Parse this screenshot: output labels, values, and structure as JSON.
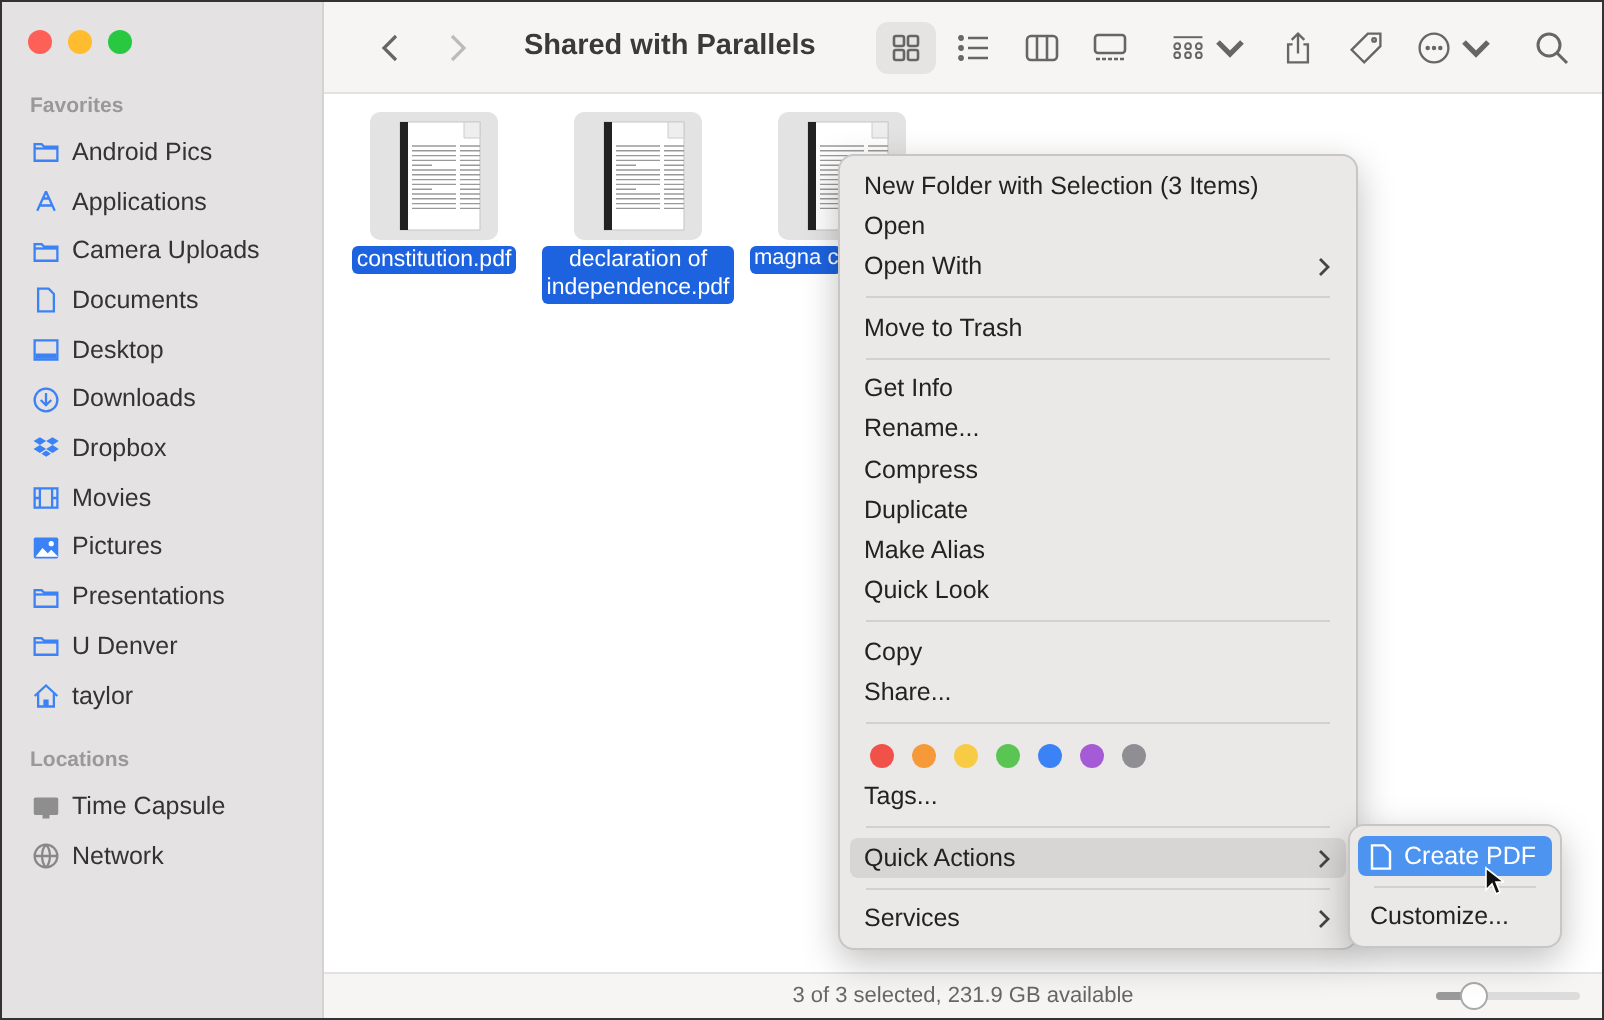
{
  "window": {
    "title": "Shared with Parallels"
  },
  "toolbar": {
    "view_modes": [
      {
        "kind": "icons",
        "selected": true
      },
      {
        "kind": "list",
        "selected": false
      },
      {
        "kind": "columns",
        "selected": false
      },
      {
        "kind": "gallery",
        "selected": false
      }
    ]
  },
  "sidebar": {
    "sections": [
      {
        "title": "Favorites",
        "items": [
          {
            "label": "Android Pics",
            "kind": "folder"
          },
          {
            "label": "Applications",
            "kind": "apps"
          },
          {
            "label": "Camera Uploads",
            "kind": "folder"
          },
          {
            "label": "Documents",
            "kind": "document"
          },
          {
            "label": "Desktop",
            "kind": "desktop"
          },
          {
            "label": "Downloads",
            "kind": "download"
          },
          {
            "label": "Dropbox",
            "kind": "dropbox"
          },
          {
            "label": "Movies",
            "kind": "film"
          },
          {
            "label": "Pictures",
            "kind": "photo"
          },
          {
            "label": "Presentations",
            "kind": "folder"
          },
          {
            "label": "U Denver",
            "kind": "folder"
          },
          {
            "label": "taylor",
            "kind": "home"
          }
        ]
      },
      {
        "title": "Locations",
        "items": [
          {
            "label": "Time Capsule",
            "kind": "disk"
          },
          {
            "label": "Network",
            "kind": "globe"
          }
        ]
      }
    ]
  },
  "files": [
    {
      "name": "constitution.pdf",
      "selected": true
    },
    {
      "name": "declaration of independence.pdf",
      "selected": true
    },
    {
      "name": "magna c",
      "selected": true
    }
  ],
  "context_menu": {
    "groups": [
      [
        {
          "label": "New Folder with Selection (3 Items)",
          "submenu": false,
          "selected": false
        },
        {
          "label": "Open",
          "submenu": false,
          "selected": false
        },
        {
          "label": "Open With",
          "submenu": true,
          "selected": false
        }
      ],
      [
        {
          "label": "Move to Trash",
          "submenu": false,
          "selected": false
        }
      ],
      [
        {
          "label": "Get Info",
          "submenu": false,
          "selected": false
        },
        {
          "label": "Rename...",
          "submenu": false,
          "selected": false
        },
        {
          "label": "Compress",
          "submenu": false,
          "selected": false
        },
        {
          "label": "Duplicate",
          "submenu": false,
          "selected": false
        },
        {
          "label": "Make Alias",
          "submenu": false,
          "selected": false
        },
        {
          "label": "Quick Look",
          "submenu": false,
          "selected": false
        }
      ],
      [
        {
          "label": "Copy",
          "submenu": false,
          "selected": false
        },
        {
          "label": "Share...",
          "submenu": false,
          "selected": false
        }
      ],
      [
        {
          "kind": "tags",
          "tags": [
            {
              "color": "#f0524a"
            },
            {
              "color": "#f69a39"
            },
            {
              "color": "#f7cc44"
            },
            {
              "color": "#5bc553"
            },
            {
              "color": "#3b82f6"
            },
            {
              "color": "#a55bd6"
            },
            {
              "color": "#8e8e93"
            }
          ]
        },
        {
          "label": "Tags...",
          "submenu": false,
          "selected": false
        }
      ],
      [
        {
          "label": "Quick Actions",
          "submenu": true,
          "selected": true
        }
      ],
      [
        {
          "label": "Services",
          "submenu": true,
          "selected": false
        }
      ]
    ]
  },
  "submenu": {
    "items": [
      {
        "label": "Create PDF",
        "kind": "action",
        "selected": true
      },
      {
        "label": "Customize...",
        "kind": "plain",
        "selected": false
      }
    ]
  },
  "status_bar": {
    "text": "3 of 3 selected, 231.9 GB available",
    "zoom": {
      "level": 0.26
    }
  }
}
